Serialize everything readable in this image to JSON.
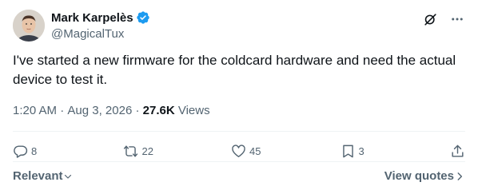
{
  "author": {
    "display_name": "Mark Karpelès",
    "handle": "@MagicalTux",
    "verified": true
  },
  "tweet": {
    "text": "I've started a new firmware for the coldcard hardware and need the actual device to test it.",
    "time": "1:20 AM",
    "date": "Aug 3, 2026",
    "views_count": "27.6K",
    "views_label": "Views"
  },
  "actions": {
    "replies": "8",
    "reposts": "22",
    "likes": "45",
    "bookmarks": "3"
  },
  "footer": {
    "sort_label": "Relevant",
    "quotes_label": "View quotes"
  },
  "colors": {
    "verified": "#1d9bf0",
    "secondary_text": "#536471",
    "primary_text": "#0f1419"
  },
  "icons": {
    "grok": "grok-icon",
    "more": "more-icon",
    "reply": "reply-icon",
    "repost": "repost-icon",
    "like": "heart-icon",
    "bookmark": "bookmark-icon",
    "share": "share-icon"
  }
}
